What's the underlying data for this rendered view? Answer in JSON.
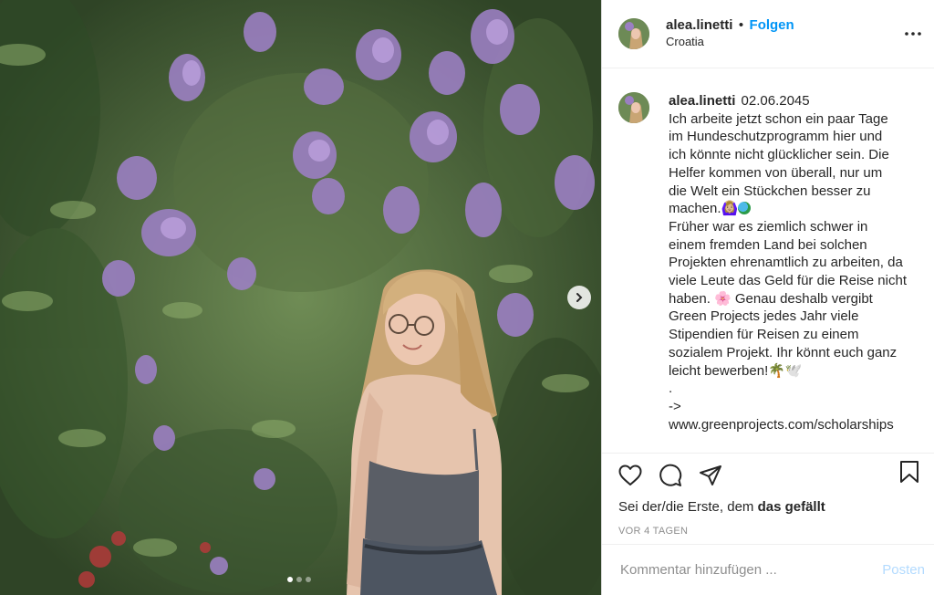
{
  "post": {
    "image": {
      "description_icon": "photo-of-girl-in-front-of-lilac-bush",
      "slide_current": 1,
      "slide_total": 3
    },
    "header": {
      "username": "alea.linetti",
      "separator": "•",
      "follow_label": "Folgen",
      "location": "Croatia"
    },
    "caption": {
      "username": "alea.linetti",
      "date": "02.06.2045",
      "lines": [
        "Ich arbeite jetzt schon ein paar Tage",
        "im Hundeschutzprogramm hier und",
        "ich könnte nicht glücklicher sein. Die",
        "Helfer kommen von überall, nur um",
        "die Welt ein Stückchen besser zu",
        "machen.🙆🏼‍♀️",
        "Früher war es ziemlich schwer in",
        "einem fremden Land bei solchen",
        "Projekten ehrenamtlich zu arbeiten, da",
        "viele Leute das Geld für die Reise nicht",
        "haben. 🌸 Genau deshalb vergibt",
        "Green Projects jedes Jahr viele",
        "Stipendien für Reisen zu einem",
        "sozialem Projekt. Ihr könnt euch ganz",
        "leicht bewerben!🌴🕊️",
        ".",
        "->"
      ],
      "link": "www.greenprojects.com/scholarships"
    },
    "likes": {
      "prefix": "Sei der/die Erste, dem ",
      "bold": "das gefällt"
    },
    "timestamp": "VOR 4 TAGEN",
    "comment": {
      "placeholder": "Kommentar hinzufügen ...",
      "post_label": "Posten"
    },
    "colors": {
      "accent": "#0095f6",
      "post_disabled": "#b3dbff",
      "muted": "#8e8e8e"
    }
  }
}
